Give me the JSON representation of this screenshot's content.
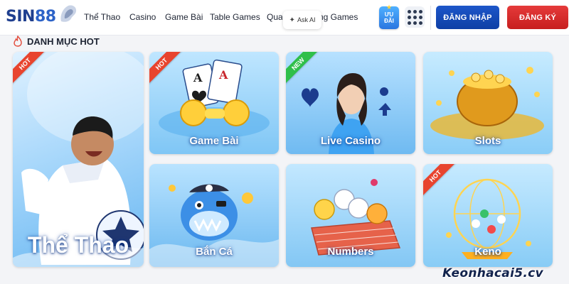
{
  "brand": {
    "logo_main": "SIN",
    "logo_num": "88"
  },
  "nav": {
    "items": [
      {
        "label": "Thể Thao"
      },
      {
        "label": "Casino"
      },
      {
        "label": "Game Bài"
      },
      {
        "label": "Table Games"
      },
      {
        "label": "Quay"
      },
      {
        "label": "ng Games"
      }
    ]
  },
  "ask_ai": {
    "label": "Ask AI",
    "icon": "sparkle-icon"
  },
  "promo": {
    "line1": "ƯU",
    "line2": "ĐÃI",
    "icon": "gift-icon"
  },
  "apps_menu": {
    "icon": "grid-icon"
  },
  "auth": {
    "login_label": "ĐĂNG NHẬP",
    "register_label": "ĐĂNG KÝ"
  },
  "section": {
    "title": "DANH MỤC HOT",
    "icon": "flame-icon"
  },
  "cards": [
    {
      "label": "Thể Thao",
      "badge": "HOT"
    },
    {
      "label": "Game Bài",
      "badge": "HOT"
    },
    {
      "label": "Live Casino",
      "badge": "NEW"
    },
    {
      "label": "Slots",
      "badge": ""
    },
    {
      "label": "Bắn Cá",
      "badge": ""
    },
    {
      "label": "Numbers",
      "badge": ""
    },
    {
      "label": "Keno",
      "badge": "HOT"
    }
  ],
  "watermark": "Keonhacai5.cv",
  "colors": {
    "login": "#1d56c9",
    "register": "#e53a3a",
    "hot_ribbon": "#e8442e",
    "new_ribbon": "#2fbf4a",
    "brand_blue": "#1f3f8f"
  }
}
